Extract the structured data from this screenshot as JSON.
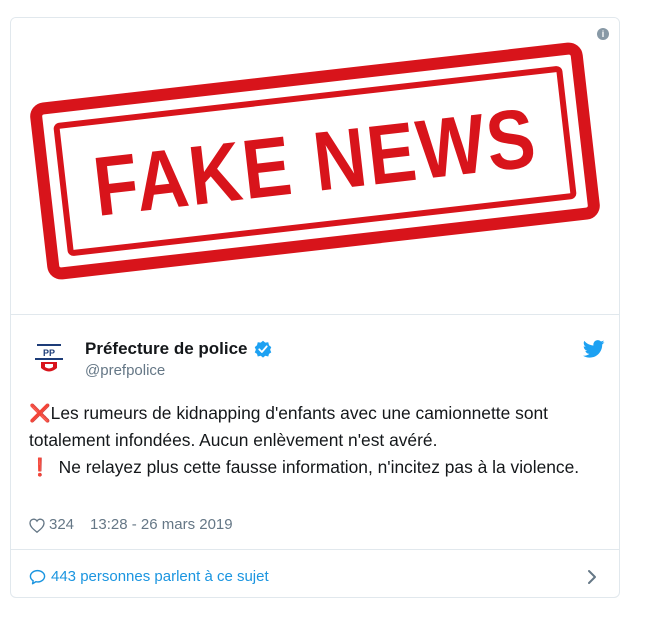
{
  "media": {
    "stamp_text": "FAKE NEWS",
    "stamp_color": "#d8141b"
  },
  "author": {
    "name": "Préfecture de police",
    "handle": "@prefpolice",
    "verified": true,
    "avatar_icon": "prefecture-logo-icon"
  },
  "tweet": {
    "line1_mark": "❌",
    "line1_text": "Les rumeurs de kidnapping d'enfants avec une camionnette sont totalement infondées. Aucun enlèvement n'est avéré.",
    "line2_mark": "❗",
    "line2_text": "Ne relayez plus cette fausse information, n'incitez pas à la violence."
  },
  "meta": {
    "likes": "324",
    "timestamp": "13:28 - 26 mars 2019"
  },
  "footer": {
    "conversation_label": "443 personnes parlent à ce sujet"
  },
  "colors": {
    "link_blue": "#1b95e0",
    "twitter_blue": "#1da1f2",
    "muted": "#657786",
    "border": "#e1e8ed"
  }
}
